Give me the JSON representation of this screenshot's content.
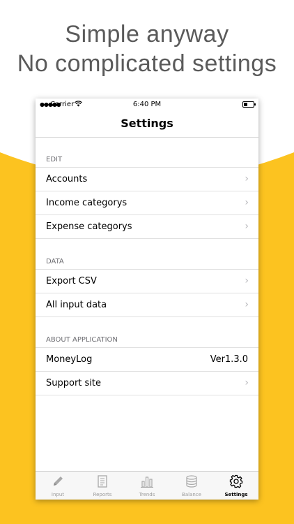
{
  "headline": {
    "line1": "Simple anyway",
    "line2": "No complicated settings"
  },
  "colors": {
    "accent": "#fcc320",
    "headline_text": "#5a5a5a"
  },
  "status_bar": {
    "carrier": "Carrier",
    "time": "6:40 PM"
  },
  "nav": {
    "title": "Settings"
  },
  "sections": [
    {
      "title": "EDIT",
      "rows": [
        {
          "label": "Accounts"
        },
        {
          "label": "Income categorys"
        },
        {
          "label": "Expense categorys"
        }
      ]
    },
    {
      "title": "DATA",
      "rows": [
        {
          "label": "Export CSV"
        },
        {
          "label": "All input data"
        }
      ]
    },
    {
      "title": "ABOUT APPLICATION",
      "rows": [
        {
          "label": "MoneyLog",
          "value": "Ver1.3.0"
        },
        {
          "label": "Support site"
        }
      ]
    }
  ],
  "tabs": [
    {
      "label": "Input",
      "icon": "pencil-icon"
    },
    {
      "label": "Reports",
      "icon": "document-icon"
    },
    {
      "label": "Trends",
      "icon": "bar-chart-icon"
    },
    {
      "label": "Balance",
      "icon": "database-icon"
    },
    {
      "label": "Settings",
      "icon": "gear-icon",
      "active": true
    }
  ]
}
